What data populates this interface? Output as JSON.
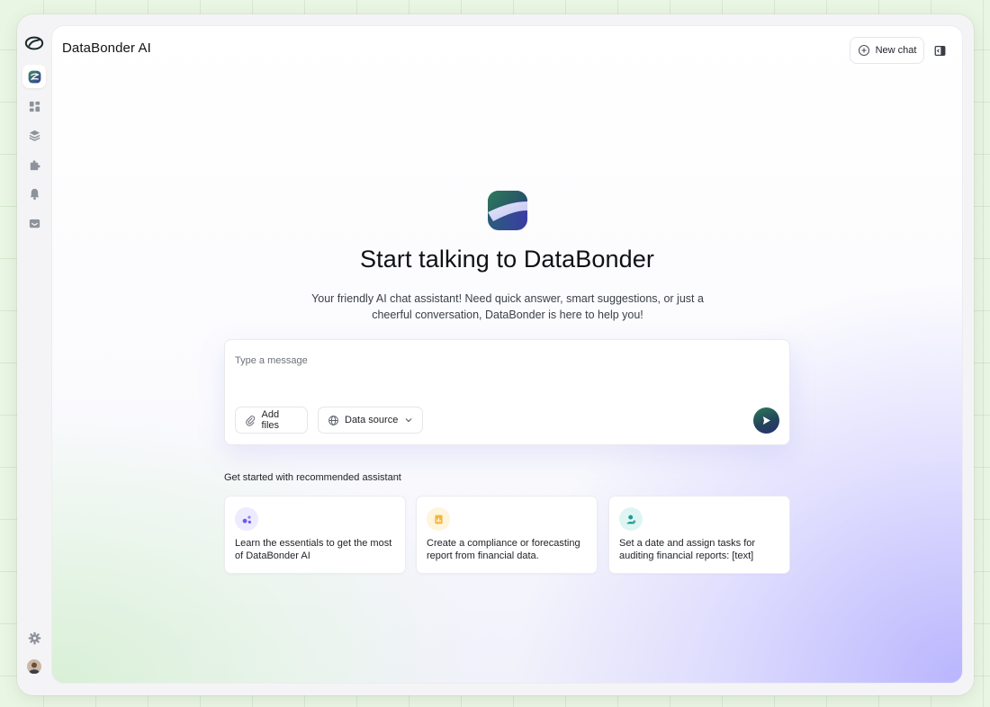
{
  "app": {
    "title": "DataBonder AI",
    "brand_colors": {
      "primary": "#2a6e55",
      "secondary": "#3a3f9a",
      "accent": "#bdb8ff"
    }
  },
  "rail": {
    "items": [
      {
        "name": "logo-mark-icon"
      },
      {
        "name": "databonder-ai-icon",
        "active": true
      },
      {
        "name": "dashboard-grid-icon"
      },
      {
        "name": "layers-icon"
      },
      {
        "name": "puzzle-plugin-icon"
      },
      {
        "name": "bell-notification-icon"
      },
      {
        "name": "inbox-icon"
      },
      {
        "name": "gear-settings-icon"
      },
      {
        "name": "user-avatar"
      }
    ]
  },
  "header": {
    "new_chat_label": "New chat",
    "new_chat_icon": "plus-circle-icon",
    "panel_toggle_icon": "sidebar-panel-icon"
  },
  "hero": {
    "title": "Start talking to DataBonder",
    "subtitle": "Your friendly AI chat assistant! Need quick answer, smart suggestions, or just a cheerful conversation, DataBonder is here to help you!"
  },
  "composer": {
    "placeholder": "Type a message",
    "value": "",
    "add_files_label": "Add files",
    "data_source_label": "Data source",
    "send_icon": "send-arrow-icon"
  },
  "recommended": {
    "heading": "Get started with recommended assistant",
    "cards": [
      {
        "text": "Learn the essentials to get the most of DataBonder AI",
        "icon": "sparkle-dots-icon",
        "color": "#6b5cf0"
      },
      {
        "text": "Create a compliance or forecasting report from financial data.",
        "icon": "chart-document-icon",
        "color": "#f2b63c"
      },
      {
        "text": "Set a date and assign tasks for auditing financial reports: [text]",
        "icon": "user-assign-icon",
        "color": "#1f9a93"
      }
    ]
  }
}
